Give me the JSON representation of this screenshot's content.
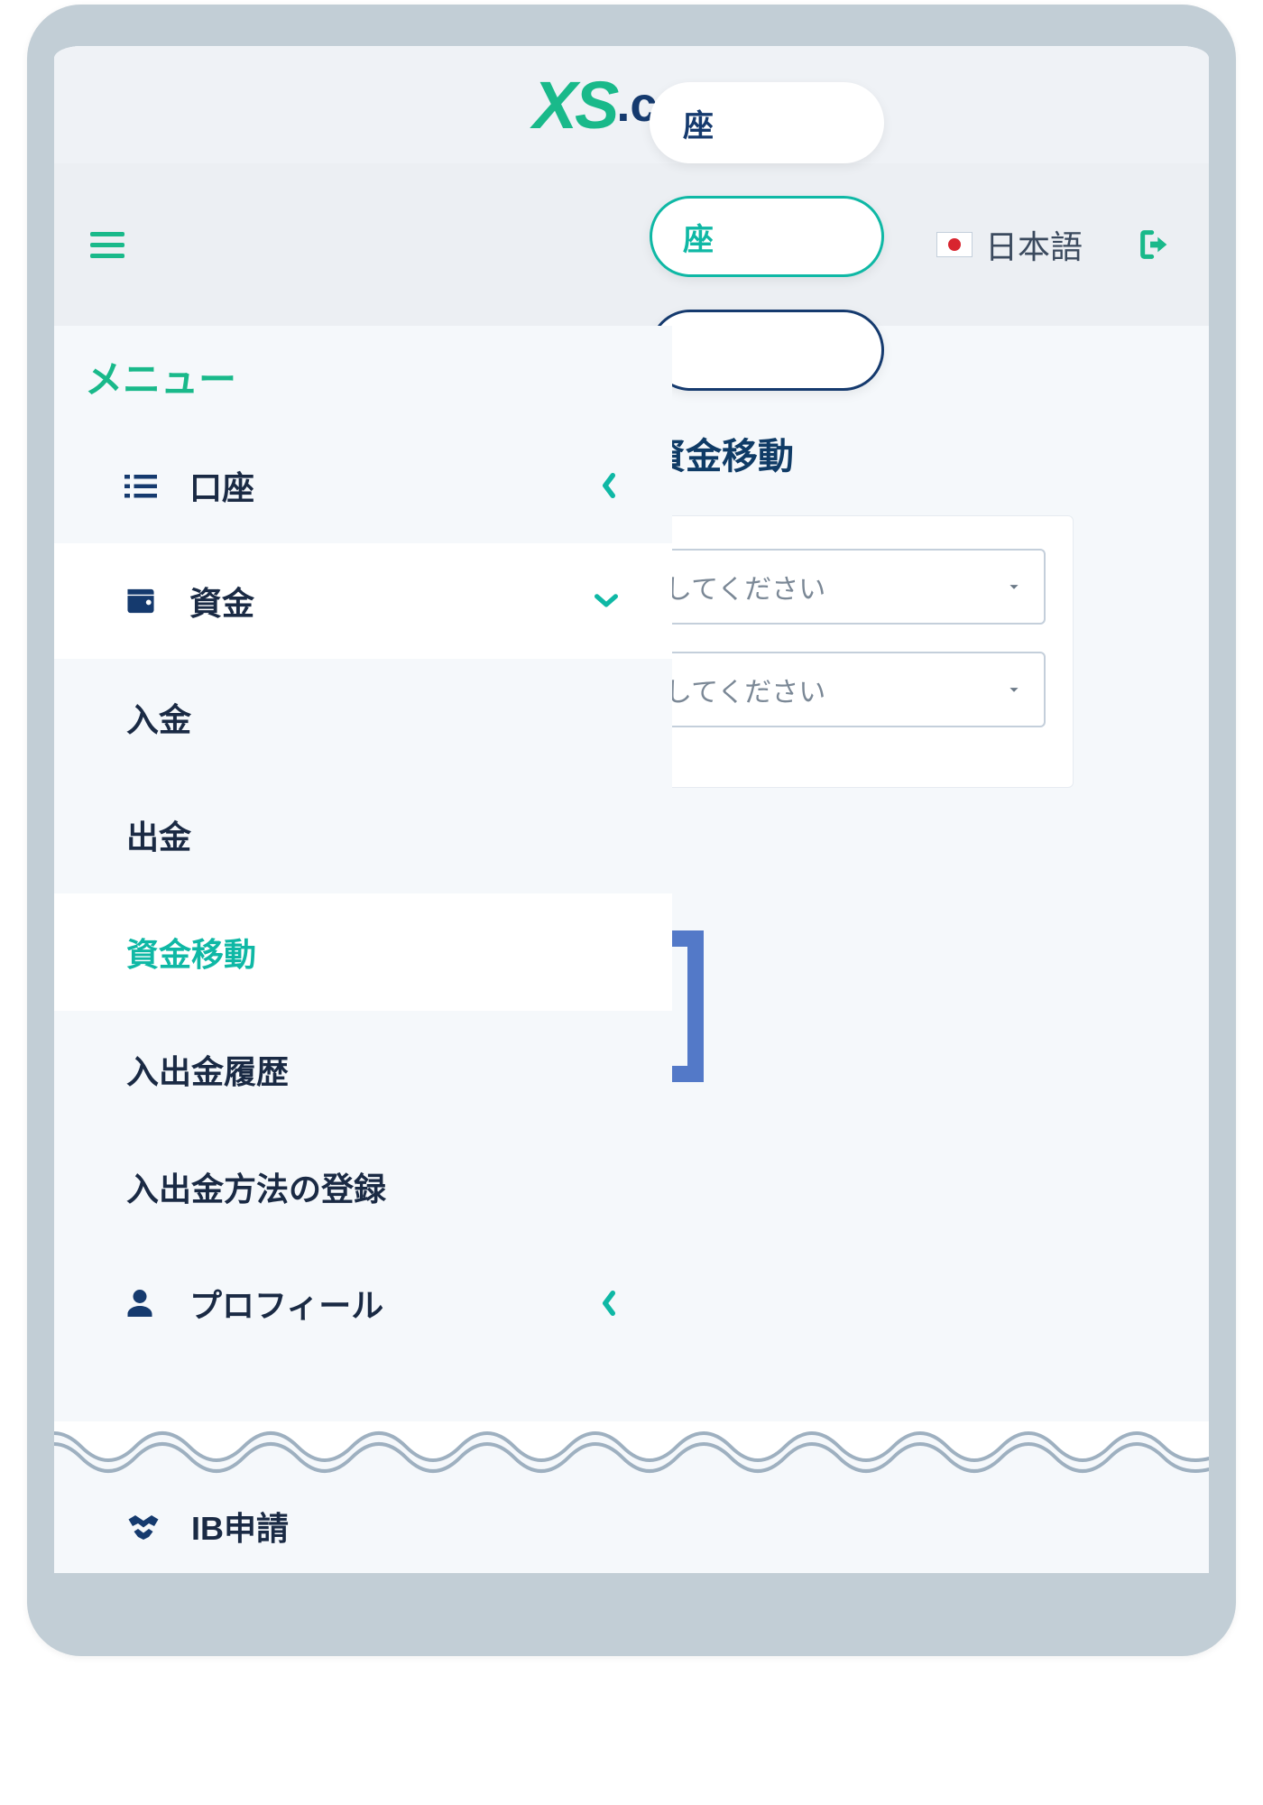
{
  "logo": {
    "xs": "XS",
    "com": ".com"
  },
  "topbar": {
    "language": "日本語"
  },
  "sidebar": {
    "title": "メニュー",
    "kouza": "口座",
    "shikin": "資金",
    "nyukin": "入金",
    "shukkin": "出金",
    "shikin_idou": "資金移動",
    "rireki": "入出金履歴",
    "houhou": "入出金方法の登録",
    "profile": "プロフィール",
    "ib": "IB申請"
  },
  "content": {
    "tab_hidden1": "座",
    "tab_hidden2": "座",
    "page_title_suffix": "資金移動",
    "select_placeholder_1": "択してください",
    "select_placeholder_2": "択してください"
  }
}
